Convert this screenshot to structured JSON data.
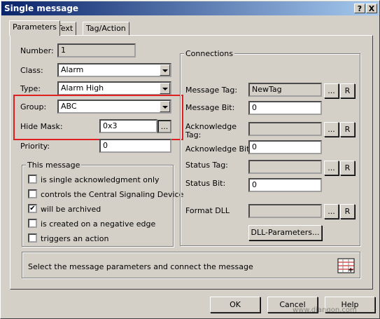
{
  "window": {
    "title": "Single message",
    "help_btn": "?",
    "close_btn": "X"
  },
  "tabs": [
    {
      "label": "Parameters"
    },
    {
      "label": "Text"
    },
    {
      "label": "Tag/Action"
    }
  ],
  "params": {
    "number_label": "Number:",
    "number_value": "1",
    "class_label": "Class:",
    "class_value": "Alarm",
    "type_label": "Type:",
    "type_value": "Alarm High",
    "group_label": "Group:",
    "group_value": "ABC",
    "hidemask_label": "Hide Mask:",
    "hidemask_value": "0x3",
    "hidemask_btn": "...",
    "priority_label": "Priority:",
    "priority_value": "0"
  },
  "this_message": {
    "title": "This message",
    "options": [
      {
        "label": "is single acknowledgment only",
        "checked": false,
        "mark": ""
      },
      {
        "label": "controls the Central Signaling Device",
        "checked": false,
        "mark": ""
      },
      {
        "label": "will be archived",
        "checked": true,
        "mark": "✔"
      },
      {
        "label": "is created on a negative edge",
        "checked": false,
        "mark": ""
      },
      {
        "label": "triggers an action",
        "checked": false,
        "mark": ""
      }
    ]
  },
  "connections": {
    "title": "Connections",
    "message_tag_label": "Message Tag:",
    "message_tag_value": "NewTag",
    "message_bit_label": "Message Bit:",
    "message_bit_value": "0",
    "ack_tag_label_1": "Acknowledge",
    "ack_tag_label_2": "Tag:",
    "ack_tag_value": "",
    "ack_bit_label": "Acknowledge Bit:",
    "ack_bit_value": "0",
    "status_tag_label": "Status Tag:",
    "status_tag_value": "",
    "status_bit_label": "Status Bit:",
    "status_bit_value": "0",
    "format_dll_label": "Format DLL",
    "format_dll_value": "",
    "dots": "...",
    "r": "R",
    "dll_params_btn": "DLL-Parameters..."
  },
  "hint": {
    "text": "Select the message parameters and connect the message"
  },
  "footer": {
    "ok": "OK",
    "cancel": "Cancel",
    "help": "Help",
    "watermark": "www.diangon.com"
  },
  "colors": {
    "highlight_box": "#e02020",
    "title_start": "#0a246a",
    "title_end": "#a6caf0"
  }
}
